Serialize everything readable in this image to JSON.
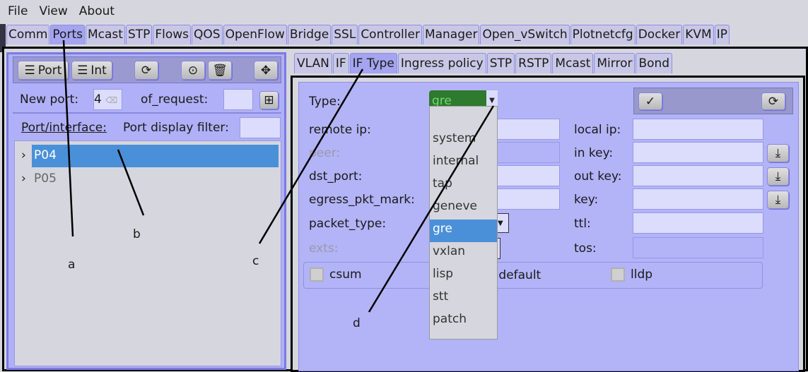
{
  "menu": [
    "File",
    "View",
    "About"
  ],
  "top_tabs": [
    "Comm",
    "Ports",
    "Mcast",
    "STP",
    "Flows",
    "QOS",
    "OpenFlow",
    "Bridge",
    "SSL",
    "Controller",
    "Manager",
    "Open_vSwitch",
    "Plotnetcfg",
    "Docker",
    "KVM",
    "IP"
  ],
  "left": {
    "port_btn": "Port",
    "int_btn": "Int",
    "new_port_label": "New port:",
    "new_port_value": "4",
    "of_request_label": "of_request:",
    "port_interface_label": "Port/interface:",
    "filter_label": "Port display filter:",
    "tree": [
      "P04",
      "P05"
    ]
  },
  "sub_tabs": [
    "VLAN",
    "IF",
    "IF Type",
    "Ingress policy",
    "STP",
    "RSTP",
    "Mcast",
    "Mirror",
    "Bond"
  ],
  "form": {
    "type_label": "Type:",
    "type_value": "gre",
    "remote_ip": "remote ip:",
    "peer": "peer:",
    "dst_port": "dst_port:",
    "egress": "egress_pkt_mark:",
    "packet_type": "packet_type:",
    "exts": "exts:",
    "local_ip": "local ip:",
    "in_key": "in key:",
    "out_key": "out key:",
    "key": "key:",
    "ttl": "ttl:",
    "tos": "tos:",
    "csum": "csum",
    "default": ".default",
    "lldp": "lldp"
  },
  "dropdown": [
    "",
    "system",
    "internal",
    "tap",
    "geneve",
    "gre",
    "vxlan",
    "lisp",
    "stt",
    "patch"
  ],
  "annotations": [
    "a",
    "b",
    "c",
    "d"
  ]
}
